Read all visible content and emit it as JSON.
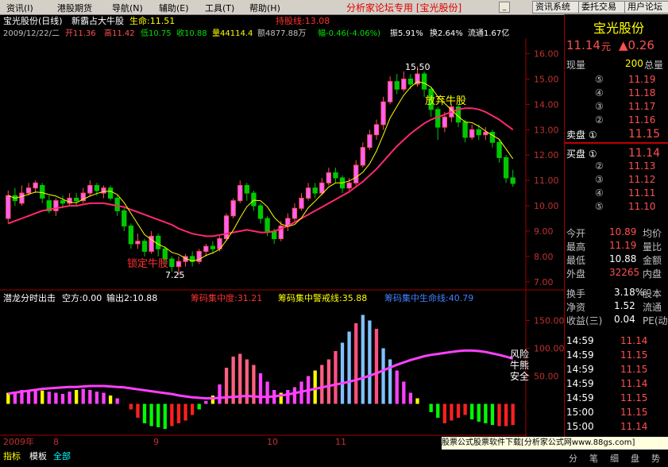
{
  "window": {
    "stock_tab": "宝光股份(日线)",
    "indicator_name": "新霸占大牛股",
    "life_label": "生命:11.51",
    "hold_label": "持股线:13.08",
    "title": "分析家论坛专用 [宝光股份]"
  },
  "menu": [
    "资讯(I)",
    "港股期货",
    "导航(N)",
    "辅助(E)",
    "工具(T)",
    "帮助(H)"
  ],
  "toolbar_buttons": [
    "资讯系统",
    "委托交易",
    "用户论坛"
  ],
  "quote_line": {
    "date": "2009/12/22/二",
    "open": "开11.36",
    "high": "高11.42",
    "low": "低10.75",
    "close": "收10.88",
    "volume": "量44114.4",
    "amount": "额4877.88万",
    "change": "幅-0.46(-4.06%)",
    "amplitude": "振5.91%",
    "turnover": "换2.64%",
    "float": "流通1.67亿"
  },
  "annotations": {
    "peak": "15.50",
    "low": "7.25",
    "sell_text": "放弃牛股",
    "buy_text": "锁定牛股",
    "risk_text": "风险",
    "bull_text": "牛熊",
    "safe_text": "安全"
  },
  "price_axis": [
    "16.00",
    "15.00",
    "14.00",
    "13.00",
    "12.00",
    "11.00",
    "10.00",
    "9.00",
    "8.00",
    "7.00"
  ],
  "sub_axis": [
    "150.00",
    "100.00",
    "50.00"
  ],
  "sub_header": {
    "name": "潜龙分时出击",
    "empty": "空方:0.00",
    "output": "输出2:10.88",
    "chip_conc": "筹码集中度:31.21",
    "chip_warn": "筹码集中警戒线:35.88",
    "chip_life": "筹码集中生命线:40.79"
  },
  "date_axis": [
    "2009年",
    "8",
    "9",
    "10",
    "11"
  ],
  "bottom_tabs": [
    "指标",
    "模板",
    "全部"
  ],
  "ad_text": "股票公式股票软件下载[分析家公式网www.88gs.com]",
  "right_panel": {
    "name": "宝光股份",
    "price": "11.14",
    "unit": "元",
    "change": "▲0.26",
    "volume_label": "现量",
    "volume_value": "200",
    "total_label": "总量",
    "sell": [
      {
        "label": "⑤",
        "price": "11.19"
      },
      {
        "label": "④",
        "price": "11.18"
      },
      {
        "label": "③",
        "price": "11.17"
      },
      {
        "label": "②",
        "price": "11.16"
      },
      {
        "label": "卖盘 ①",
        "price": "11.15"
      }
    ],
    "buy": [
      {
        "label": "买盘 ①",
        "price": "11.14"
      },
      {
        "label": "②",
        "price": "11.13"
      },
      {
        "label": "③",
        "price": "11.12"
      },
      {
        "label": "④",
        "price": "11.11"
      },
      {
        "label": "⑤",
        "price": "11.10"
      }
    ],
    "stats": [
      {
        "label": "今开",
        "value": "10.89",
        "label2": "均价"
      },
      {
        "label": "最高",
        "value": "11.19",
        "label2": "量比"
      },
      {
        "label": "最低",
        "value": "10.88",
        "label2": "金额"
      },
      {
        "label": "外盘",
        "value": "32265",
        "label2": "内盘"
      }
    ],
    "fin": [
      {
        "label": "换手",
        "value": "3.18%",
        "label2": "股本"
      },
      {
        "label": "净资",
        "value": "1.52",
        "label2": "流通"
      },
      {
        "label": "收益(三)",
        "value": "0.04",
        "label2": "PE(动)"
      }
    ],
    "ticks": [
      {
        "time": "14:59",
        "price": "11.14"
      },
      {
        "time": "14:59",
        "price": "11.15"
      },
      {
        "time": "14:59",
        "price": "11.15"
      },
      {
        "time": "14:59",
        "price": "11.14"
      },
      {
        "time": "14:59",
        "price": "11.15"
      },
      {
        "time": "15:00",
        "price": "11.15"
      },
      {
        "time": "15:00",
        "price": "11.14"
      }
    ],
    "bottom_tabs": [
      "分",
      "笔",
      "细",
      "盘",
      "势"
    ]
  },
  "colors": {
    "up": "#ff5050",
    "down": "#00c800",
    "up_fill": "#ff60ff",
    "ma_long": "#ff2870",
    "ma_short": "#ffff00",
    "axis": "#a00000",
    "accent": "#ffff00",
    "cyan": "#00ffff"
  },
  "chart_data": {
    "type": "candlestick",
    "ylim": [
      6.9,
      16.3
    ],
    "candles": [
      [
        9.5,
        10.4,
        10.6,
        9.3
      ],
      [
        10.4,
        10.2,
        10.7,
        10.0
      ],
      [
        10.1,
        10.5,
        10.8,
        10.0
      ],
      [
        10.5,
        10.7,
        10.9,
        10.4
      ],
      [
        10.7,
        10.9,
        11.0,
        10.5
      ],
      [
        10.8,
        10.3,
        10.9,
        10.1
      ],
      [
        10.2,
        9.8,
        10.4,
        9.7
      ],
      [
        9.8,
        10.2,
        10.3,
        9.6
      ],
      [
        10.2,
        10.1,
        10.4,
        9.9
      ],
      [
        10.1,
        10.3,
        10.5,
        10.0
      ],
      [
        10.3,
        10.2,
        10.5,
        10.0
      ],
      [
        10.2,
        10.5,
        10.7,
        10.1
      ],
      [
        10.5,
        10.8,
        11.0,
        10.4
      ],
      [
        10.8,
        10.6,
        10.9,
        10.4
      ],
      [
        10.5,
        10.7,
        10.8,
        10.3
      ],
      [
        10.7,
        10.3,
        10.8,
        10.2
      ],
      [
        10.3,
        9.8,
        10.4,
        9.6
      ],
      [
        9.8,
        9.2,
        9.9,
        9.0
      ],
      [
        9.2,
        8.5,
        9.3,
        8.3
      ],
      [
        8.5,
        8.6,
        8.9,
        8.3
      ],
      [
        8.6,
        8.2,
        8.7,
        8.0
      ],
      [
        8.2,
        8.8,
        9.0,
        8.1
      ],
      [
        8.8,
        8.3,
        8.9,
        8.0
      ],
      [
        8.3,
        7.9,
        8.4,
        7.7
      ],
      [
        7.9,
        7.6,
        8.0,
        7.4
      ],
      [
        7.6,
        7.8,
        8.0,
        7.25
      ],
      [
        7.8,
        8.0,
        8.1,
        7.6
      ],
      [
        8.0,
        7.8,
        8.2,
        7.6
      ],
      [
        7.8,
        8.2,
        8.3,
        7.7
      ],
      [
        8.2,
        8.4,
        8.5,
        8.0
      ],
      [
        8.4,
        8.3,
        8.6,
        8.1
      ],
      [
        8.3,
        8.7,
        8.8,
        8.2
      ],
      [
        8.7,
        9.6,
        9.7,
        8.6
      ],
      [
        9.6,
        10.2,
        10.3,
        9.5
      ],
      [
        10.2,
        10.8,
        11.0,
        10.1
      ],
      [
        10.8,
        10.5,
        10.9,
        10.2
      ],
      [
        10.5,
        10.0,
        10.6,
        9.8
      ],
      [
        10.0,
        9.5,
        10.1,
        9.3
      ],
      [
        9.5,
        9.0,
        9.6,
        8.8
      ],
      [
        9.0,
        8.7,
        9.1,
        8.5
      ],
      [
        8.7,
        9.2,
        9.4,
        8.6
      ],
      [
        9.2,
        9.5,
        9.7,
        9.0
      ],
      [
        9.5,
        9.9,
        10.1,
        9.4
      ],
      [
        9.9,
        10.3,
        10.5,
        9.8
      ],
      [
        10.3,
        10.7,
        10.9,
        10.2
      ],
      [
        10.7,
        10.5,
        10.9,
        10.3
      ],
      [
        10.5,
        10.9,
        11.1,
        10.4
      ],
      [
        10.9,
        11.3,
        11.5,
        10.8
      ],
      [
        11.3,
        11.1,
        11.5,
        10.9
      ],
      [
        11.1,
        10.7,
        11.2,
        10.5
      ],
      [
        10.7,
        10.9,
        11.1,
        10.6
      ],
      [
        10.9,
        11.6,
        11.8,
        10.8
      ],
      [
        11.6,
        12.3,
        12.5,
        11.5
      ],
      [
        12.3,
        12.8,
        13.0,
        12.2
      ],
      [
        12.8,
        13.2,
        13.4,
        12.6
      ],
      [
        13.2,
        14.1,
        14.3,
        13.0
      ],
      [
        14.1,
        14.9,
        15.1,
        14.0
      ],
      [
        14.9,
        14.6,
        15.2,
        14.4
      ],
      [
        14.6,
        15.0,
        15.3,
        14.5
      ],
      [
        15.0,
        14.8,
        15.2,
        14.6
      ],
      [
        14.8,
        15.2,
        15.5,
        14.7
      ],
      [
        15.2,
        14.6,
        15.3,
        14.3
      ],
      [
        14.6,
        13.8,
        14.7,
        13.5
      ],
      [
        13.8,
        13.1,
        13.9,
        12.6
      ],
      [
        13.1,
        13.5,
        13.7,
        12.9
      ],
      [
        13.5,
        13.9,
        14.0,
        13.3
      ],
      [
        13.9,
        13.3,
        14.0,
        13.1
      ],
      [
        13.3,
        12.7,
        13.4,
        12.5
      ],
      [
        12.7,
        13.0,
        13.2,
        12.6
      ],
      [
        13.0,
        12.8,
        13.2,
        12.6
      ],
      [
        12.8,
        12.9,
        13.1,
        12.6
      ],
      [
        12.9,
        12.5,
        13.0,
        12.3
      ],
      [
        12.5,
        11.9,
        12.6,
        11.7
      ],
      [
        11.9,
        11.1,
        12.0,
        10.9
      ],
      [
        11.1,
        10.88,
        11.42,
        10.75
      ]
    ],
    "ma_long": [
      9.3,
      9.4,
      9.5,
      9.6,
      9.7,
      9.8,
      9.85,
      9.9,
      9.95,
      10.0,
      10.0,
      10.05,
      10.1,
      10.1,
      10.1,
      10.05,
      10.0,
      9.95,
      9.85,
      9.75,
      9.65,
      9.55,
      9.45,
      9.35,
      9.25,
      9.1,
      9.0,
      8.9,
      8.85,
      8.8,
      8.8,
      8.85,
      8.9,
      8.95,
      9.0,
      9.05,
      9.0,
      8.95,
      8.95,
      9.0,
      9.1,
      9.2,
      9.35,
      9.5,
      9.65,
      9.8,
      9.95,
      10.1,
      10.25,
      10.4,
      10.55,
      10.75,
      10.95,
      11.2,
      11.45,
      11.75,
      12.05,
      12.35,
      12.6,
      12.85,
      13.05,
      13.25,
      13.4,
      13.5,
      13.6,
      13.7,
      13.8,
      13.85,
      13.85,
      13.8,
      13.7,
      13.55,
      13.4,
      13.2,
      13.0
    ],
    "sub": {
      "ylim": [
        -45,
        175
      ],
      "bars": [
        20,
        22,
        25,
        23,
        26,
        24,
        22,
        20,
        18,
        22,
        25,
        27,
        25,
        22,
        20,
        15,
        10,
        0,
        -10,
        -25,
        -35,
        -40,
        -42,
        -45,
        -40,
        -35,
        -30,
        -20,
        -10,
        5,
        15,
        35,
        65,
        85,
        90,
        80,
        70,
        55,
        40,
        25,
        20,
        25,
        30,
        40,
        50,
        60,
        70,
        80,
        95,
        110,
        130,
        145,
        160,
        150,
        135,
        100,
        80,
        60,
        40,
        20,
        10,
        0,
        -15,
        -25,
        -35,
        -30,
        -25,
        -20,
        -28,
        -32,
        -35,
        -38,
        -40,
        -40,
        -38
      ]
    }
  }
}
